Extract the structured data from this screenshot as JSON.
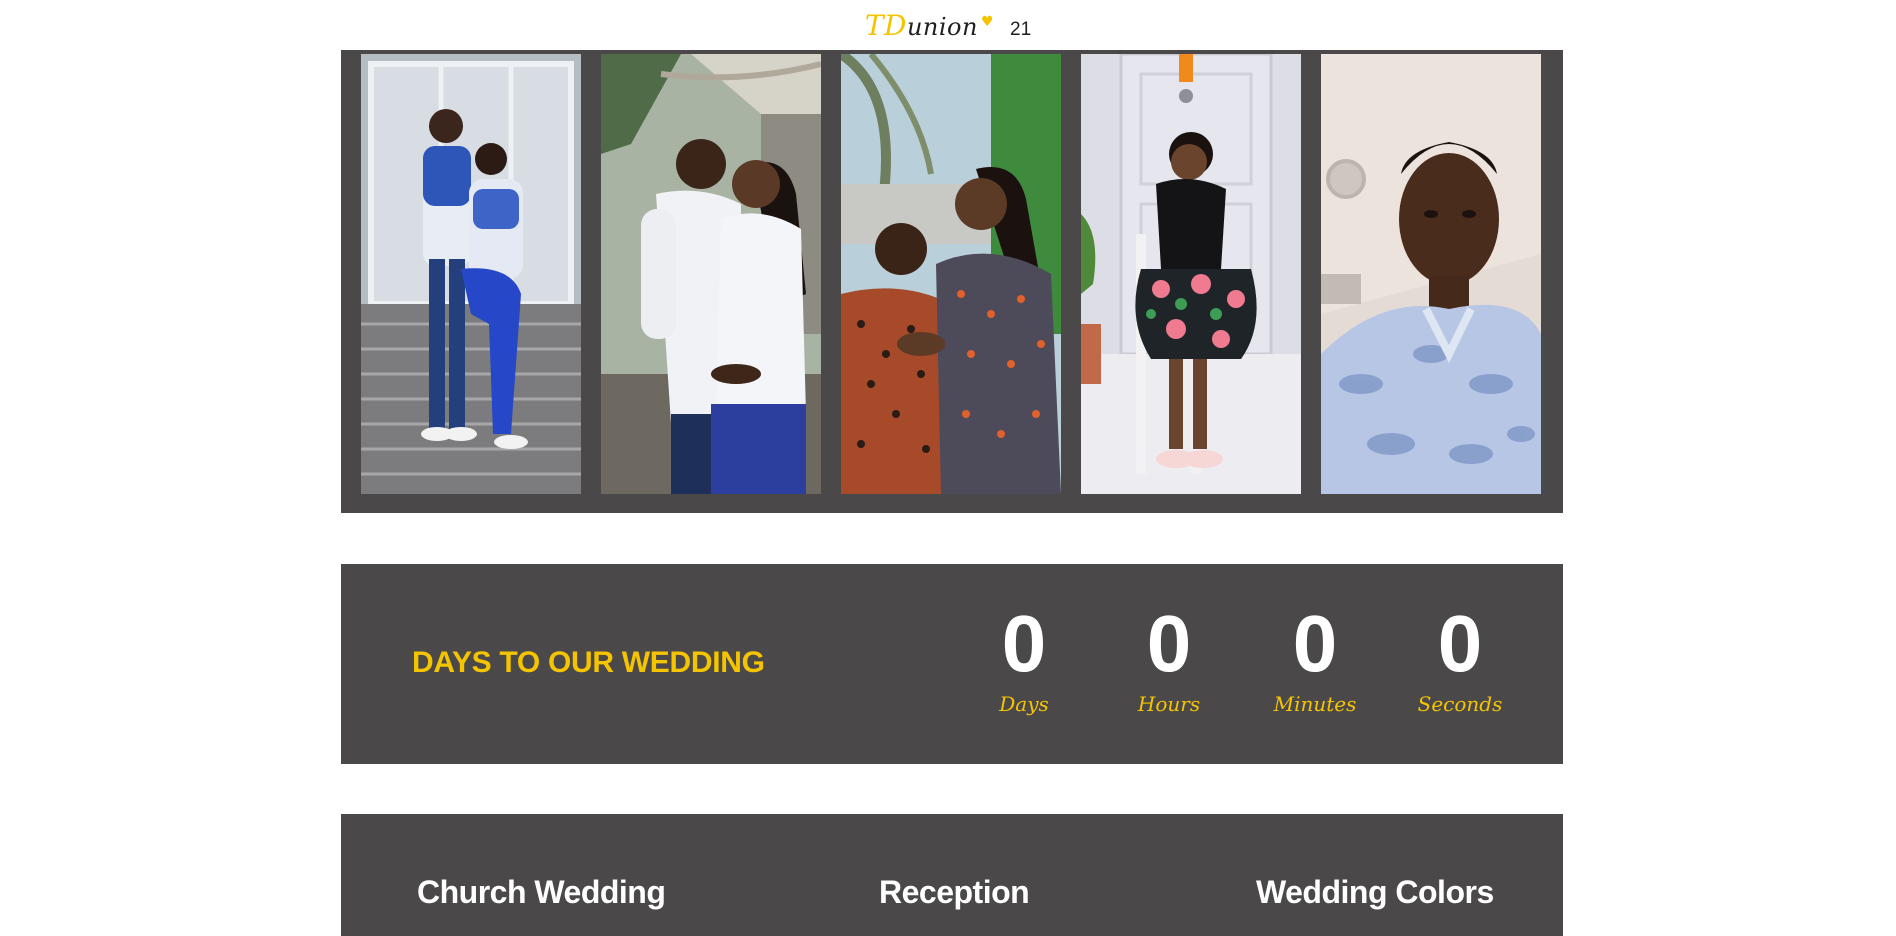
{
  "header": {
    "logo_script": "TDunion",
    "logo_initials": "TD",
    "logo_rest": "union",
    "logo_number": "21"
  },
  "gallery": {
    "photos": [
      {
        "name": "couple-on-stairs-photo"
      },
      {
        "name": "couple-white-sweaters-photo"
      },
      {
        "name": "couple-ankara-photo"
      },
      {
        "name": "bride-seated-photo"
      },
      {
        "name": "groom-selfie-photo"
      }
    ]
  },
  "countdown": {
    "title": "DAYS TO OUR WEDDING",
    "units": [
      {
        "value": "0",
        "label": "Days"
      },
      {
        "value": "0",
        "label": "Hours"
      },
      {
        "value": "0",
        "label": "Minutes"
      },
      {
        "value": "0",
        "label": "Seconds"
      }
    ]
  },
  "details": {
    "headings": [
      "Church Wedding",
      "Reception",
      "Wedding Colors"
    ]
  },
  "colors": {
    "panel_bg": "#4a4849",
    "accent_yellow": "#f5c400",
    "text_white": "#ffffff"
  }
}
